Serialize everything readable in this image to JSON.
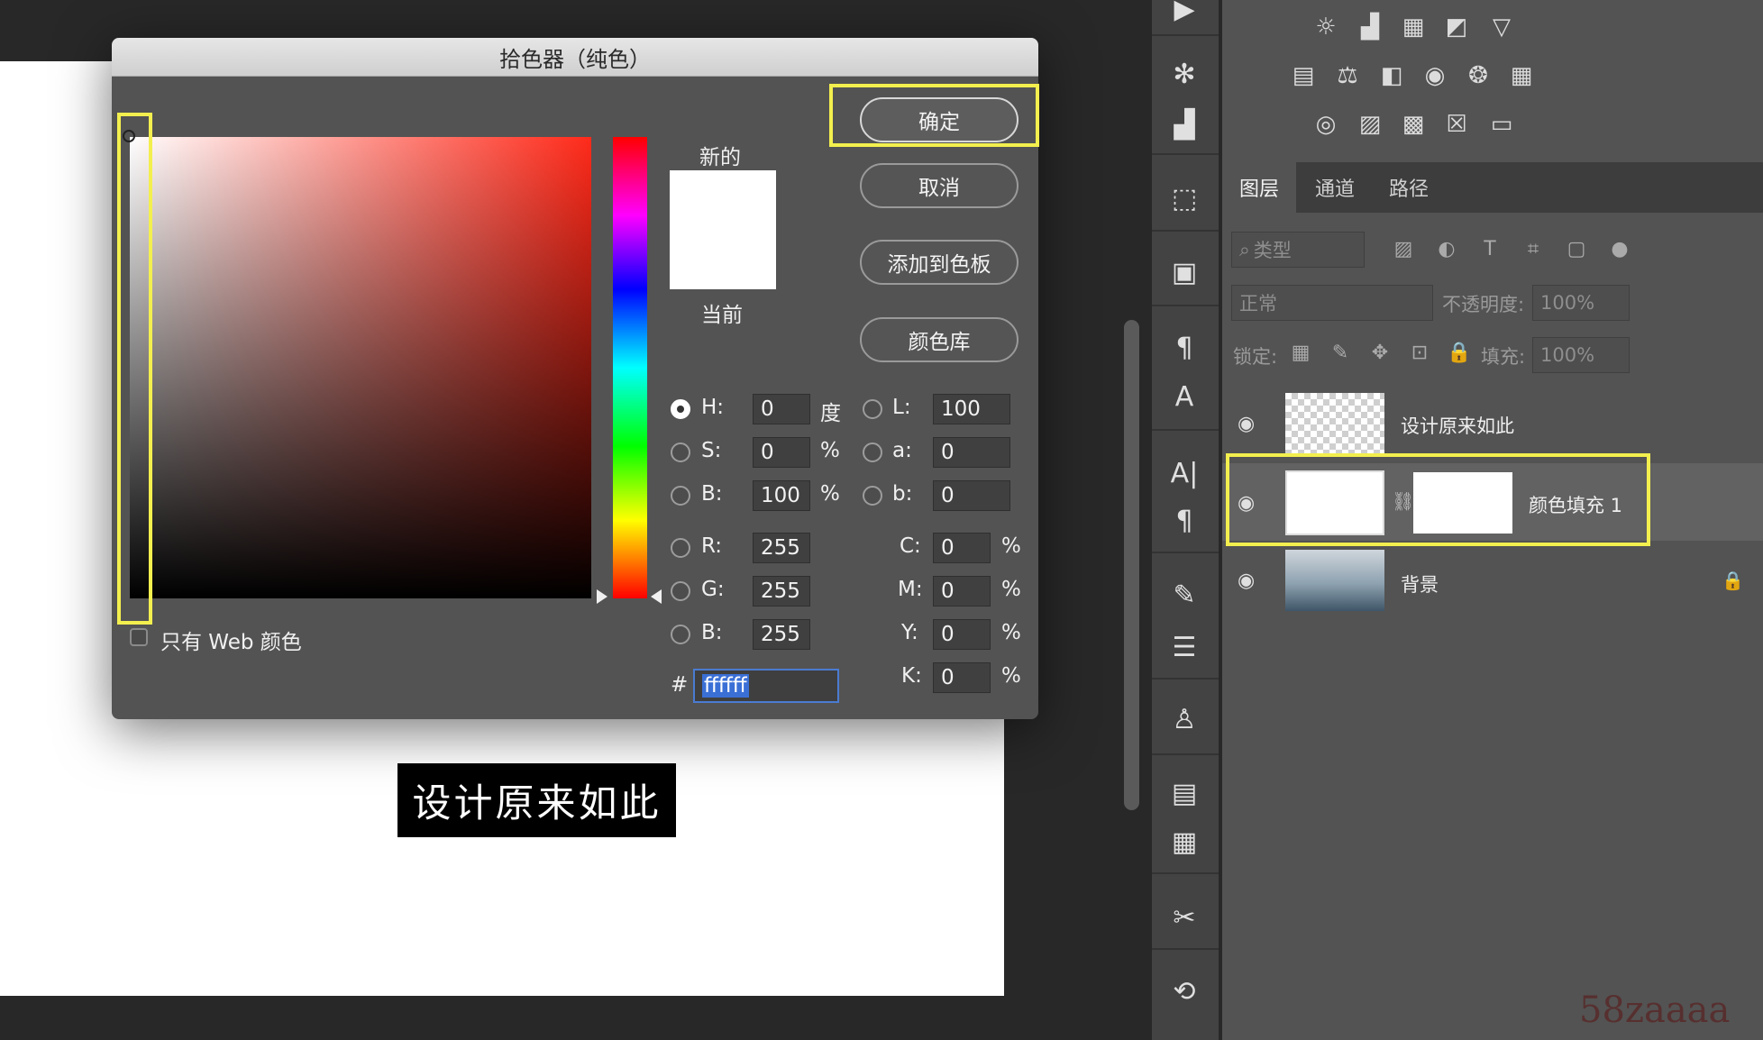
{
  "canvas": {
    "caption": "设计原来如此"
  },
  "dialog": {
    "title": "拾色器（纯色）",
    "buttons": {
      "ok": "确定",
      "cancel": "取消",
      "add_to_swatches": "添加到色板",
      "color_libraries": "颜色库"
    },
    "swatch": {
      "new_label": "新的",
      "current_label": "当前",
      "new_color": "#ffffff",
      "current_color": "#ffffff"
    },
    "web_only_label": "只有 Web 颜色",
    "fields": {
      "H": {
        "label": "H:",
        "value": "0",
        "unit": "度"
      },
      "S": {
        "label": "S:",
        "value": "0",
        "unit": "%"
      },
      "Bv": {
        "label": "B:",
        "value": "100",
        "unit": "%"
      },
      "R": {
        "label": "R:",
        "value": "255"
      },
      "G": {
        "label": "G:",
        "value": "255"
      },
      "Bc": {
        "label": "B:",
        "value": "255"
      },
      "L": {
        "label": "L:",
        "value": "100"
      },
      "a": {
        "label": "a:",
        "value": "0"
      },
      "b": {
        "label": "b:",
        "value": "0"
      },
      "C": {
        "label": "C:",
        "value": "0",
        "unit": "%"
      },
      "M": {
        "label": "M:",
        "value": "0",
        "unit": "%"
      },
      "Y": {
        "label": "Y:",
        "value": "0",
        "unit": "%"
      },
      "K": {
        "label": "K:",
        "value": "0",
        "unit": "%"
      }
    },
    "hex": {
      "prefix": "#",
      "value": "ffffff"
    }
  },
  "panel": {
    "tabs": [
      "图层",
      "通道",
      "路径"
    ],
    "filter_placeholder": "类型",
    "blend_mode": "正常",
    "opacity_label": "不透明度:",
    "opacity_value": "100%",
    "lock_label": "锁定:",
    "fill_label": "填充:",
    "fill_value": "100%",
    "layers": [
      {
        "name": "设计原来如此"
      },
      {
        "name": "颜色填充 1"
      },
      {
        "name": "背景"
      }
    ]
  },
  "watermark": "58zaaaa"
}
